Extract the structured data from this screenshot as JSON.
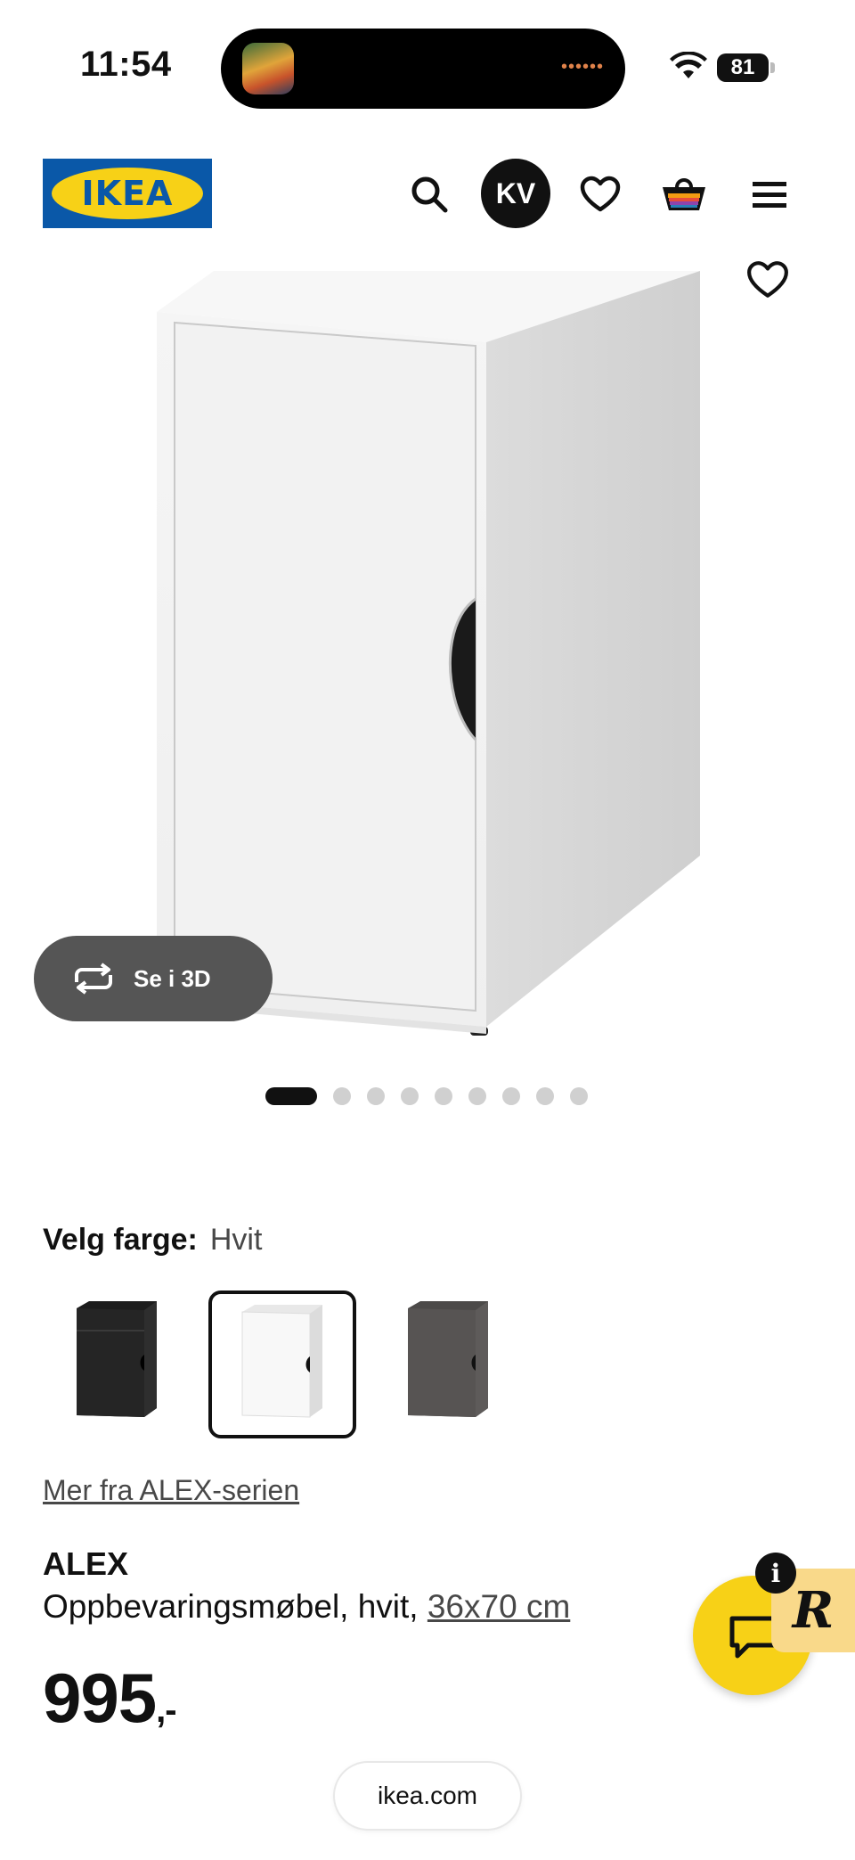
{
  "status_bar": {
    "time": "11:54",
    "battery": "81",
    "island_dots": "••••••"
  },
  "header": {
    "logo_text": "IKEA",
    "avatar_initials": "KV",
    "brand_blue": "#0a58a8",
    "brand_yellow": "#f7d117"
  },
  "product_gallery": {
    "view_3d_label": "Se i 3D",
    "image_count": 9,
    "active_index": 0
  },
  "color_selection": {
    "label": "Velg farge:",
    "value": "Hvit",
    "options": [
      {
        "name": "black",
        "color": "#2a2a2a",
        "selected": false
      },
      {
        "name": "white",
        "color": "#ffffff",
        "selected": true
      },
      {
        "name": "grey",
        "color": "#5a5857",
        "selected": false
      }
    ]
  },
  "series_link": "Mer fra ALEX-serien",
  "product": {
    "name": "ALEX",
    "description": "Oppbevaringsmøbel, hvit, ",
    "size": "36x70 cm",
    "price": "995",
    "price_suffix": ",-"
  },
  "browser": {
    "url": "ikea.com"
  }
}
